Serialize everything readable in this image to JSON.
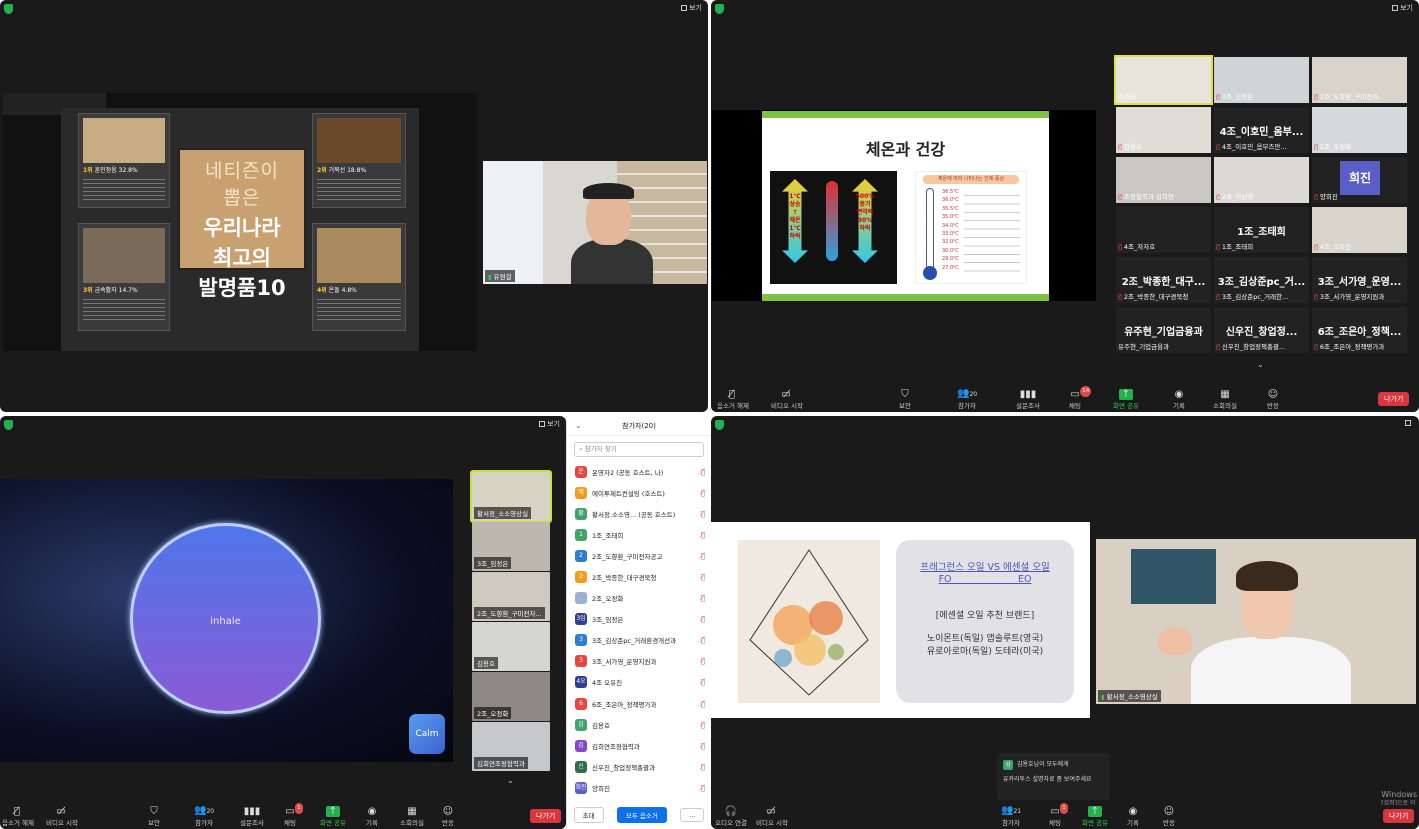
{
  "common": {
    "view_label": "보기",
    "leave_label": "나가기"
  },
  "q1": {
    "book": {
      "line1": "네티즌이",
      "line2": "뽑은",
      "line3": "우리나라",
      "line4": "최고의",
      "line5": "발명품10"
    },
    "cards": [
      {
        "rank": "1위",
        "name": "훈민정음",
        "pct": "32.8%"
      },
      {
        "rank": "2위",
        "name": "거북선",
        "pct": "18.8%"
      },
      {
        "rank": "3위",
        "name": "금속활자",
        "pct": "14.7%"
      },
      {
        "rank": "4위",
        "name": "온돌",
        "pct": "4.8%"
      }
    ],
    "cam_name": "유원걸"
  },
  "q2": {
    "slide_title": "체온과 건강",
    "panel_a_left_lines": [
      "1℃",
      "상승",
      "↑",
      "체온",
      "1℃",
      "하락"
    ],
    "panel_a_right_lines": [
      "500%",
      "증가",
      "면역력",
      "30%",
      "하락"
    ],
    "panel_b_title": "체온에 따라 나타나는 인체 증상",
    "temps": [
      "36.5℃",
      "36.0℃",
      "35.5℃",
      "35.0℃",
      "34.0℃",
      "33.0℃",
      "32.0℃",
      "30.0℃",
      "29.0℃",
      "27.0℃"
    ],
    "tiles": [
      {
        "big": "",
        "name": "이주아",
        "photo": true,
        "muted": false,
        "active": true
      },
      {
        "big": "",
        "name": "3조_임정은",
        "photo": true,
        "muted": true
      },
      {
        "big": "",
        "name": "2조_도향환_구미전자...",
        "photo": true,
        "muted": true
      },
      {
        "big": "",
        "name": "김용호",
        "photo": true,
        "muted": true
      },
      {
        "big": "4조_이호민_옴부...",
        "name": "4조_이호민_옴부즈만...",
        "photo": false,
        "muted": true
      },
      {
        "big": "",
        "name": "2조_오정화",
        "photo": true,
        "muted": true
      },
      {
        "big": "",
        "name": "조정협력과 김희연",
        "photo": true,
        "muted": true
      },
      {
        "big": "",
        "name": "2조_이신영",
        "photo": true,
        "muted": true
      },
      {
        "big": "희진",
        "name": "양희진",
        "photo": false,
        "muted": true
      },
      {
        "big": "",
        "name": "4조_자자호",
        "photo": false,
        "muted": true
      },
      {
        "big": "1조_조태희",
        "name": "1조_조태희",
        "photo": false,
        "muted": true
      },
      {
        "big": "",
        "name": "4조_오유진",
        "photo": true,
        "muted": true
      },
      {
        "big": "2조_박종한_대구...",
        "name": "2조_박종한_대구경북청",
        "photo": false,
        "muted": true
      },
      {
        "big": "3조_김상준pc_거...",
        "name": "3조_김상준pc_거래한...",
        "photo": false,
        "muted": true
      },
      {
        "big": "3조_서가영_운영...",
        "name": "3조_서가영_운영지원과",
        "photo": false,
        "muted": true
      },
      {
        "big": "유주현_기업금융과",
        "name": "유주현_기업금융과",
        "photo": false,
        "muted": false
      },
      {
        "big": "신우진_창업정...",
        "name": "신우진_창업정책총괄...",
        "photo": false,
        "muted": true
      },
      {
        "big": "6조_조은아_정책...",
        "name": "6조_조은아_정책평가과",
        "photo": false,
        "muted": true
      }
    ],
    "toolbar": {
      "unmute": "음소거 해제",
      "video": "비디오 시작",
      "security": "보안",
      "participants": "참가자",
      "participants_count": "20",
      "poll": "설문조사",
      "chat": "채팅",
      "chat_badge": "14",
      "share": "화면 공유",
      "record": "기록",
      "rooms": "소회의실",
      "reactions": "반응"
    }
  },
  "q3": {
    "inhale": "inhale",
    "calm_logo": "Calm",
    "side_tiles": [
      {
        "name": "황서정_소소영상실"
      },
      {
        "name": "3조_임정은"
      },
      {
        "name": "2조_도향환_구미전자..."
      },
      {
        "name": "김용호"
      },
      {
        "name": "2조_오정화"
      },
      {
        "name": "김회연조정협력과"
      }
    ],
    "toolbar": {
      "unmute": "음소거 해제",
      "video": "비디오 시작",
      "security": "보안",
      "participants": "참가자",
      "participants_count": "20",
      "poll": "설문조사",
      "chat": "채팅",
      "chat_badge": "1",
      "share": "화면 공유",
      "record": "기록",
      "rooms": "소회의실",
      "reactions": "반응"
    }
  },
  "participants_panel": {
    "title": "참가자(20)",
    "search_placeholder": "참가자 찾기",
    "rows": [
      {
        "initial": "운",
        "color": "#e5483f",
        "name": "운영자2 (공동 호스트, 나)"
      },
      {
        "initial": "에",
        "color": "#f29c1f",
        "name": "에이투제트컨설팅 (호스트)"
      },
      {
        "initial": "황",
        "color": "#3fa36b",
        "name": "황서정.소소영... (공동 호스트)"
      },
      {
        "initial": "1",
        "color": "#3fa36b",
        "name": "1조_조태희"
      },
      {
        "initial": "2",
        "color": "#2d7dd2",
        "name": "2조_도향환_구미전자공고"
      },
      {
        "initial": "2",
        "color": "#f29c1f",
        "name": "2조_박종한_대구경북청"
      },
      {
        "initial": "",
        "color": "#9ab0d6",
        "name": "2조_오정화"
      },
      {
        "initial": "3임",
        "color": "#2f3e8f",
        "name": "3조_임정은"
      },
      {
        "initial": "3",
        "color": "#2d7dd2",
        "name": "3조_김상준pc_거래환경개선과"
      },
      {
        "initial": "3",
        "color": "#e5483f",
        "name": "3조_서가영_운영지원과"
      },
      {
        "initial": "4오",
        "color": "#2f3e8f",
        "name": "4조 오유진"
      },
      {
        "initial": "6",
        "color": "#e5483f",
        "name": "6조_조은아_정책평가과"
      },
      {
        "initial": "김",
        "color": "#3fa36b",
        "name": "김용호"
      },
      {
        "initial": "김",
        "color": "#8a45c7",
        "name": "김희연조정협력과"
      },
      {
        "initial": "신",
        "color": "#2f6b4f",
        "name": "신우진_창업정책총괄과"
      },
      {
        "initial": "희진",
        "color": "#5a5fc7",
        "name": "양희진"
      }
    ],
    "invite": "초대",
    "mute_all": "모두 음소거",
    "more": "..."
  },
  "q4": {
    "box_title_1": "프래그런스 오일  VS 에센셜 오일",
    "box_title_2": "FO                      EO",
    "box_sub": "[에센셜 오일 추천 브랜드]",
    "box_line1": "노이몬트(독일) 앱솔루트(영국)",
    "box_line2": "유로아로마(독일) 도테라(미국)",
    "cam_name": "황서정_소소영상실",
    "toast_from": "김용호님이 모두에게",
    "toast_msg": "유카리투스 설명자료 좀 보여주세요",
    "toast_initial": "김",
    "windows_1": "Windows",
    "windows_2": "[설정]으로 이",
    "toolbar": {
      "audio": "오디오 연결",
      "video": "비디오 시작",
      "participants": "참가자",
      "participants_count": "21",
      "chat": "채팅",
      "chat_badge": "1",
      "share": "화면 공유",
      "record": "기록",
      "reactions": "반응"
    }
  }
}
